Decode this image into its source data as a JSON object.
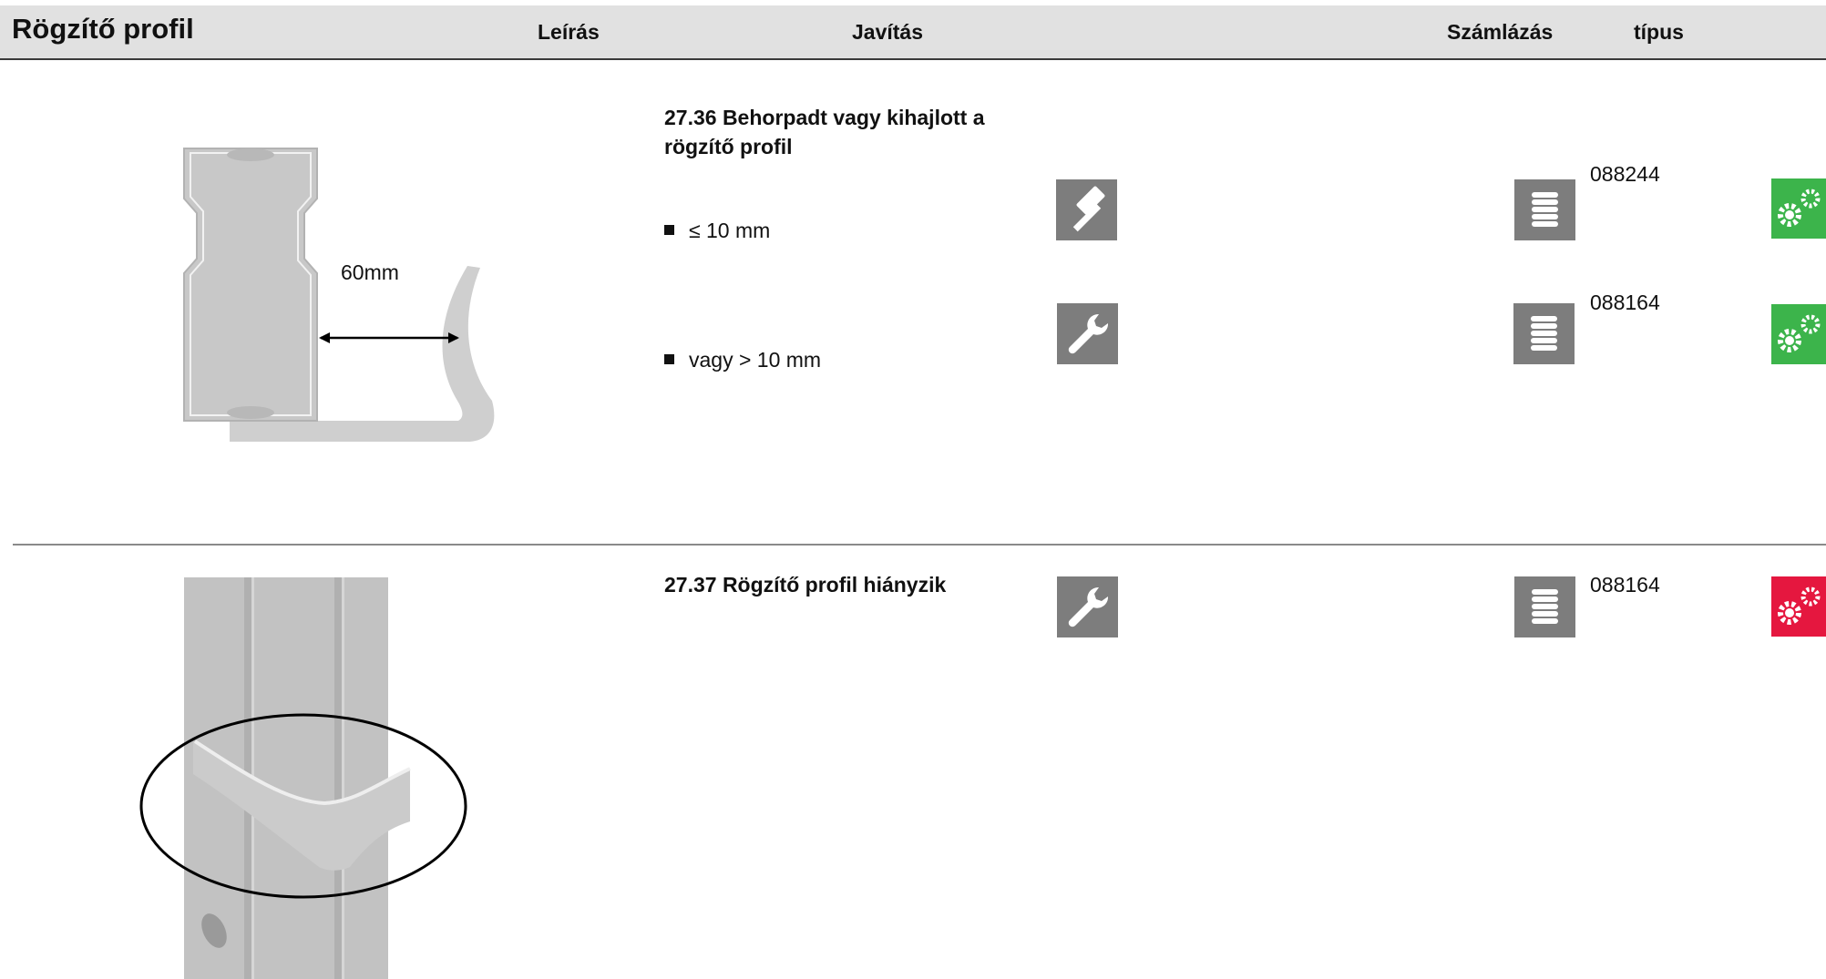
{
  "header": {
    "title": "Rögzítő profil",
    "description": "Leírás",
    "repair": "Javítás",
    "billing": "Számlázás",
    "type": "típus"
  },
  "colors": {
    "header_bg": "#e1e1e1",
    "icon_grey": "#7d7d7d",
    "status_green": "#3cb44b",
    "status_red": "#e5173f"
  },
  "sections": [
    {
      "title_line1": "27.36 Behorpadt vagy kihajlott a",
      "title_line2": "rögzítő profil",
      "dimension_label": "60mm",
      "items": [
        {
          "text": "≤ 10 mm",
          "repair_icon": "hammer-icon",
          "billing_icon": "coin-stack-icon",
          "code": "088244",
          "status": "green-gear-icon"
        },
        {
          "text": "vagy > 10 mm",
          "repair_icon": "wrench-icon",
          "billing_icon": "coin-stack-icon",
          "code": "088164",
          "status": "green-gear-icon"
        }
      ]
    },
    {
      "title": "27.37 Rögzítő profil hiányzik",
      "items": [
        {
          "repair_icon": "wrench-icon",
          "billing_icon": "coin-stack-icon",
          "code": "088164",
          "status": "red-gear-icon"
        }
      ]
    }
  ]
}
